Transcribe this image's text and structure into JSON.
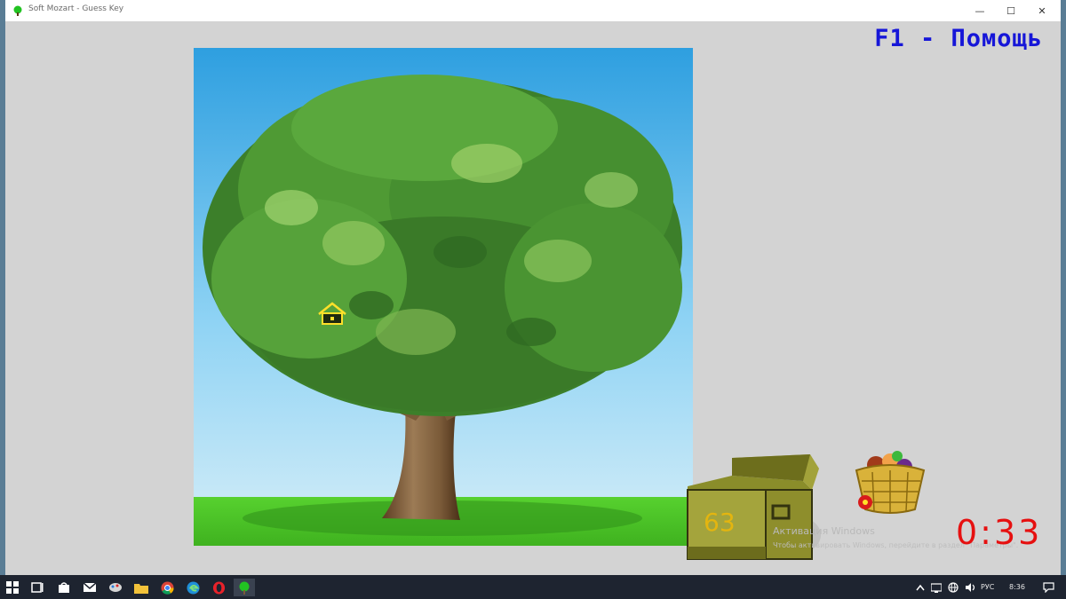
{
  "window": {
    "title": "Soft Mozart - Guess Key",
    "minimize_glyph": "—",
    "maximize_glyph": "☐",
    "close_glyph": "✕"
  },
  "game": {
    "help_text": "F1 - Помощь",
    "timer": "0:33",
    "chest_count": "63"
  },
  "watermark": {
    "line1": "Активация Windows",
    "line2": "Чтобы активировать Windows, перейдите в раздел \"Параметры\"."
  },
  "taskbar": {
    "language": "РУС",
    "time": "8:36"
  },
  "icons": [
    "window-icon",
    "start-icon",
    "task-view-icon",
    "store-icon",
    "mail-icon",
    "paint-icon",
    "explorer-icon",
    "chrome-icon",
    "edge-icon",
    "opera-icon",
    "soft-mozart-icon",
    "chevron-up-icon",
    "network-icon",
    "globe-icon",
    "volume-icon",
    "notification-icon",
    "house-icon"
  ],
  "colors": {
    "help": "#1616d8",
    "timer": "#e61010",
    "chest_number": "#e4b50f",
    "sky_top": "#2e9fe0",
    "grass": "#4fc72a"
  }
}
